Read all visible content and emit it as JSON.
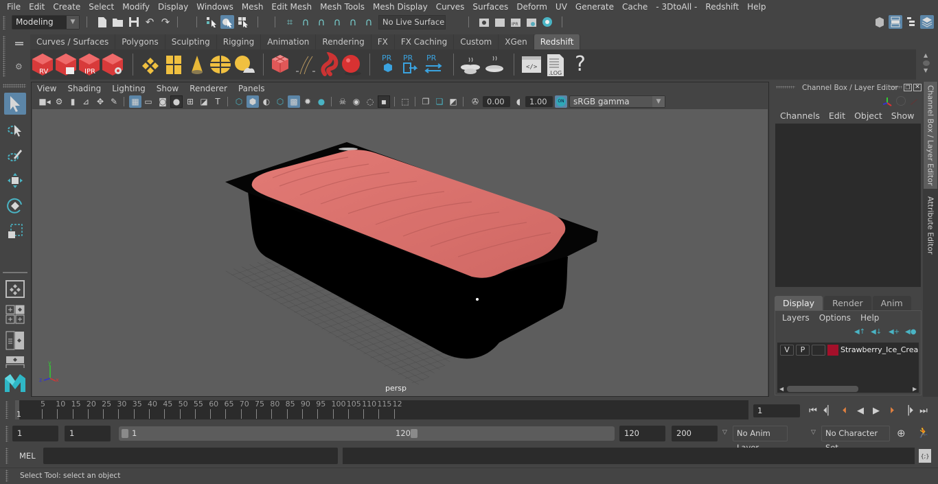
{
  "menubar": {
    "items": [
      "File",
      "Edit",
      "Create",
      "Select",
      "Modify",
      "Display",
      "Windows",
      "Mesh",
      "Edit Mesh",
      "Mesh Tools",
      "Mesh Display",
      "Curves",
      "Surfaces",
      "Deform",
      "UV",
      "Generate",
      "Cache",
      "- 3DtoAll -",
      "Redshift",
      "Help"
    ]
  },
  "statusline": {
    "mode": "Modeling",
    "live_surface": "No Live Surface"
  },
  "shelf": {
    "tabs": [
      "Curves / Surfaces",
      "Polygons",
      "Sculpting",
      "Rigging",
      "Animation",
      "Rendering",
      "FX",
      "FX Caching",
      "Custom",
      "XGen",
      "Redshift"
    ],
    "active_tab": "Redshift",
    "icon_labels": {
      "rv": "RV",
      "ipr": "IPR",
      "pr": "PR",
      "log": ".LOG",
      "help": "?"
    }
  },
  "viewport": {
    "menu": [
      "View",
      "Shading",
      "Lighting",
      "Show",
      "Renderer",
      "Panels"
    ],
    "exposure": "0.00",
    "gamma": "1.00",
    "color_mgmt_toggle": "ON",
    "color_space": "sRGB gamma",
    "camera": "persp",
    "axis_labels": {
      "x": "x",
      "y": "y",
      "z": "z"
    },
    "colors": {
      "ice_cream": "#d9716c",
      "tub": "#000000",
      "background": "#5d5d5d"
    }
  },
  "channel_box": {
    "title": "Channel Box / Layer Editor",
    "menu": [
      "Channels",
      "Edit",
      "Object",
      "Show"
    ]
  },
  "layer_editor": {
    "tabs": [
      "Display",
      "Render",
      "Anim"
    ],
    "active_tab": "Display",
    "menu": [
      "Layers",
      "Options",
      "Help"
    ],
    "layers": [
      {
        "visible": "V",
        "playback": "P",
        "color": "#a4102a",
        "name": "Strawberry_Ice_Cream_"
      }
    ]
  },
  "side_tabs": [
    "Channel Box / Layer Editor",
    "Attribute Editor"
  ],
  "timeline": {
    "ticks": [
      "5",
      "10",
      "15",
      "20",
      "25",
      "30",
      "35",
      "40",
      "45",
      "50",
      "55",
      "60",
      "65",
      "70",
      "75",
      "80",
      "85",
      "90",
      "95",
      "100",
      "105",
      "110",
      "115",
      "12"
    ],
    "current_frame_label": "1",
    "current_frame": "1"
  },
  "range": {
    "start": "1",
    "playback_start": "1",
    "slider_start": "1",
    "slider_end": "120",
    "playback_end": "120",
    "end": "200",
    "anim_layer": "No Anim Layer",
    "character_set": "No Character Set"
  },
  "command_line": {
    "label": "MEL",
    "input": "",
    "help_text": "Select Tool: select an object"
  }
}
